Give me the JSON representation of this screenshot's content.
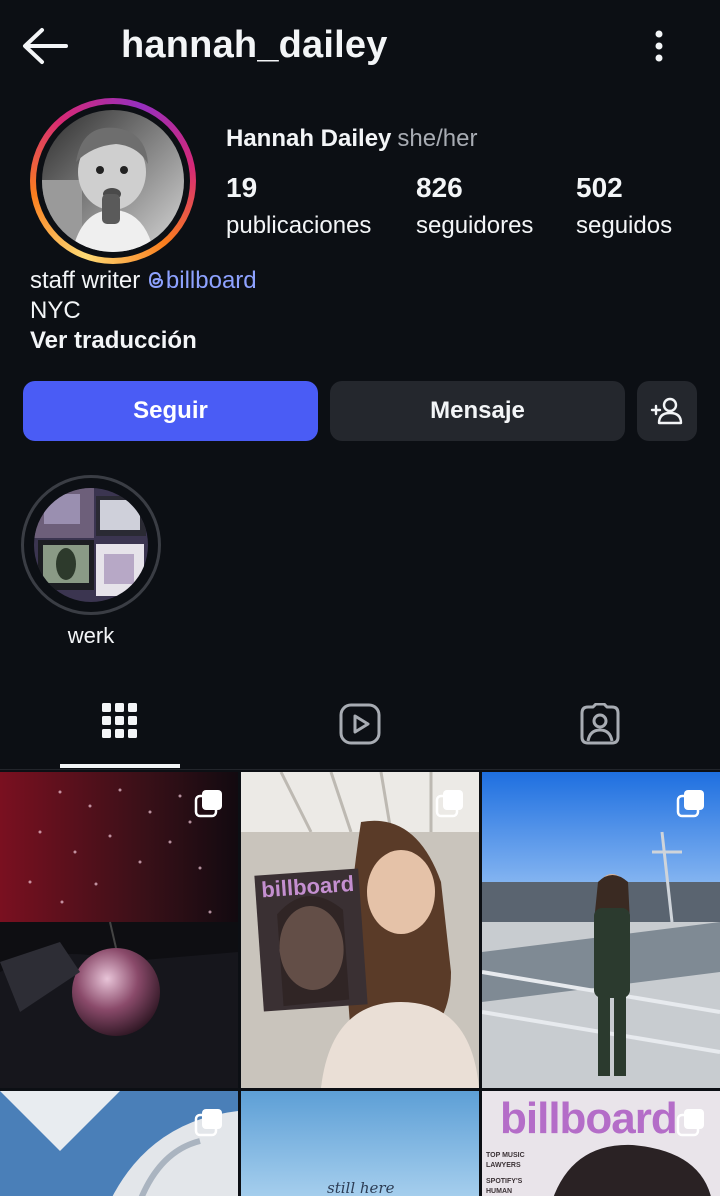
{
  "header": {
    "username": "hannah_dailey",
    "back_icon": "arrow-left-icon",
    "more_icon": "vertical-dots-icon"
  },
  "profile": {
    "full_name": "Hannah Dailey",
    "pronouns": "she/her",
    "stats": [
      {
        "value": "19",
        "label": "publicaciones"
      },
      {
        "value": "826",
        "label": "seguidores"
      },
      {
        "value": "502",
        "label": "seguidos"
      }
    ],
    "bio": {
      "line1_prefix": "staff writer ",
      "line1_link": "billboard",
      "line2": "NYC",
      "translate": "Ver traducción"
    }
  },
  "actions": {
    "follow": "Seguir",
    "message": "Mensaje",
    "add_user_icon": "add-person-icon"
  },
  "highlights": [
    {
      "label": "werk"
    }
  ],
  "tabs": [
    {
      "icon": "grid-icon",
      "active": true
    },
    {
      "icon": "reels-icon",
      "active": false
    },
    {
      "icon": "tagged-icon",
      "active": false
    }
  ],
  "posts_overlay": {
    "magazine_brand": "billboard",
    "cover_lines": [
      "TOP MUSIC",
      "LAWYERS",
      "SPOTIFY'S",
      "HUMAN"
    ],
    "sky_text": "still here"
  },
  "colors": {
    "background": "#0c0f14",
    "follow_button": "#4a5cf5",
    "secondary_button": "#24272d",
    "link": "#8ea2ff"
  }
}
